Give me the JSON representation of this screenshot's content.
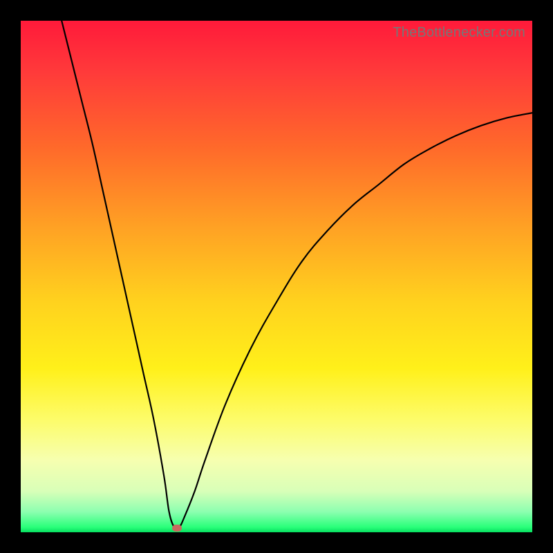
{
  "watermark": "TheBottlenecker.com",
  "chart_data": {
    "type": "line",
    "title": "",
    "xlabel": "",
    "ylabel": "",
    "xlim": [
      0,
      100
    ],
    "ylim": [
      0,
      100
    ],
    "series": [
      {
        "name": "bottleneck-curve",
        "x": [
          8,
          10,
          12,
          14,
          16,
          18,
          20,
          22,
          24,
          26,
          28,
          29,
          30,
          31,
          32,
          34,
          36,
          40,
          45,
          50,
          55,
          60,
          65,
          70,
          75,
          80,
          85,
          90,
          95,
          100
        ],
        "y": [
          100,
          92,
          84,
          76,
          67,
          58,
          49,
          40,
          31,
          22,
          11,
          4,
          1,
          1,
          3,
          8,
          14,
          25,
          36,
          45,
          53,
          59,
          64,
          68,
          72,
          75,
          77.5,
          79.5,
          81,
          82
        ]
      }
    ],
    "marker": {
      "x": 30.5,
      "y": 0.8
    },
    "colors": {
      "curve": "#000000",
      "marker": "#c9695f",
      "gradient_top": "#ff1a3a",
      "gradient_bottom": "#07e060"
    }
  }
}
